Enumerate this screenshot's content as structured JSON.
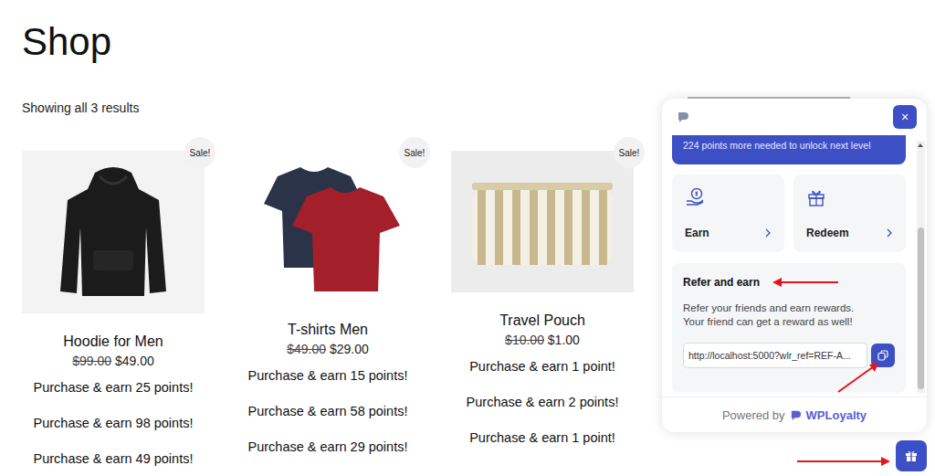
{
  "page": {
    "title": "Shop",
    "result_count": "Showing all 3 results"
  },
  "products": [
    {
      "name": "Hoodie for Men",
      "old_price": "$99.00",
      "price": "$49.00",
      "badge": "Sale!",
      "points": [
        "Purchase & earn 25 points!",
        "Purchase & earn 98 points!",
        "Purchase & earn 49 points!"
      ]
    },
    {
      "name": "T-shirts Men",
      "old_price": "$49.00",
      "price": "$29.00",
      "badge": "Sale!",
      "points": [
        "Purchase & earn 15 points!",
        "Purchase & earn 58 points!",
        "Purchase & earn 29 points!"
      ]
    },
    {
      "name": "Travel Pouch",
      "old_price": "$10.00",
      "price": "$1.00",
      "badge": "Sale!",
      "points": [
        "Purchase & earn 1 point!",
        "Purchase & earn 2 points!",
        "Purchase & earn 1 point!"
      ]
    }
  ],
  "widget": {
    "close": "×",
    "banner": "224 points more needed to unlock next level",
    "actions": [
      {
        "label": "Earn"
      },
      {
        "label": "Redeem"
      }
    ],
    "refer": {
      "title": "Refer and earn",
      "description": [
        "Refer your friends and earn rewards.",
        "Your friend can get a reward as well!"
      ],
      "link": "http://localhost:5000?wlr_ref=REF-A..."
    },
    "footer": {
      "prefix": "Powered by",
      "brand": "WPLoyalty"
    }
  }
}
